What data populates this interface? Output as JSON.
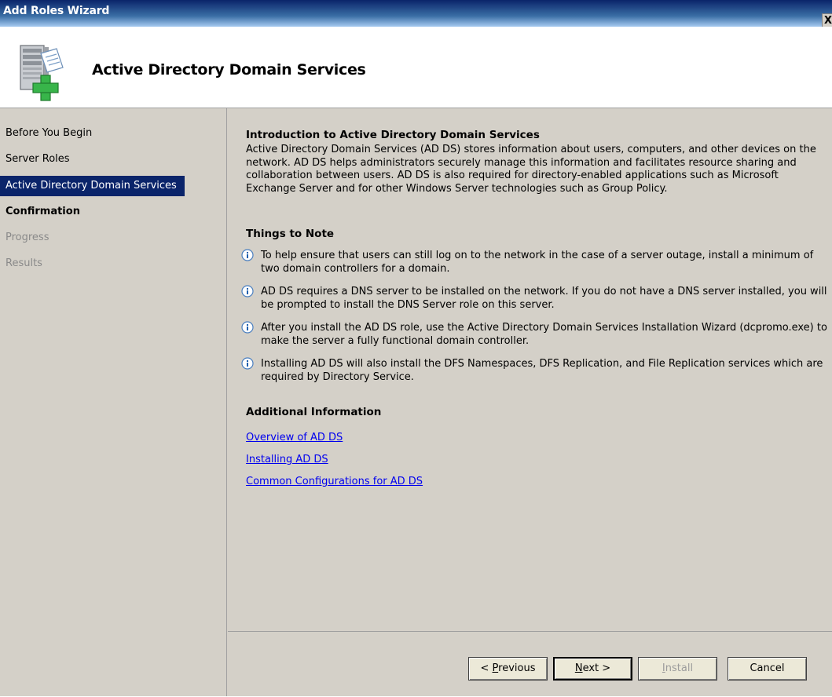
{
  "window": {
    "title": "Add Roles Wizard",
    "close_glyph": "X"
  },
  "header": {
    "icon": "server-add-icon",
    "title": "Active Directory Domain Services"
  },
  "nav": {
    "items": [
      {
        "label": "Before You Begin",
        "state": "done"
      },
      {
        "label": "Server Roles",
        "state": "done"
      },
      {
        "label": "Active Directory Domain Services",
        "state": "active"
      },
      {
        "label": "Confirmation",
        "state": "bold"
      },
      {
        "label": "Progress",
        "state": "disabled"
      },
      {
        "label": "Results",
        "state": "disabled"
      }
    ]
  },
  "main": {
    "intro_heading": "Introduction to Active Directory Domain Services",
    "intro_text": "Active Directory Domain Services (AD DS) stores information about users, computers, and other devices on the network. AD DS helps administrators securely manage this information and facilitates resource sharing and collaboration between users. AD DS is also required for directory-enabled applications such as Microsoft Exchange Server and for other Windows Server technologies such as Group Policy.",
    "notes_heading": "Things to Note",
    "notes": [
      "To help ensure that users can still log on to the network in the case of a server outage, install a minimum of two domain controllers for a domain.",
      "AD DS requires a DNS server to be installed on the network. If you do not have a DNS server installed, you will be prompted to install the DNS Server role on this server.",
      "After you install the AD DS role, use the Active Directory Domain Services Installation Wizard (dcpromo.exe) to make the server a fully functional domain controller.",
      "Installing AD DS will also install the DFS Namespaces, DFS Replication, and File Replication services which are required by Directory Service."
    ],
    "info_heading": "Additional Information",
    "links": [
      "Overview of AD DS",
      "Installing AD DS",
      "Common Configurations for AD DS"
    ]
  },
  "buttons": {
    "previous": {
      "pre": "< ",
      "key": "P",
      "rest": "revious"
    },
    "next": {
      "key": "N",
      "rest": "ext >"
    },
    "install": {
      "key": "I",
      "rest": "nstall"
    },
    "cancel": "Cancel"
  },
  "colors": {
    "titlebar": "#0a246a",
    "nav_active": "#0a246a",
    "link": "#0000ee",
    "background": "#d4d0c8"
  }
}
